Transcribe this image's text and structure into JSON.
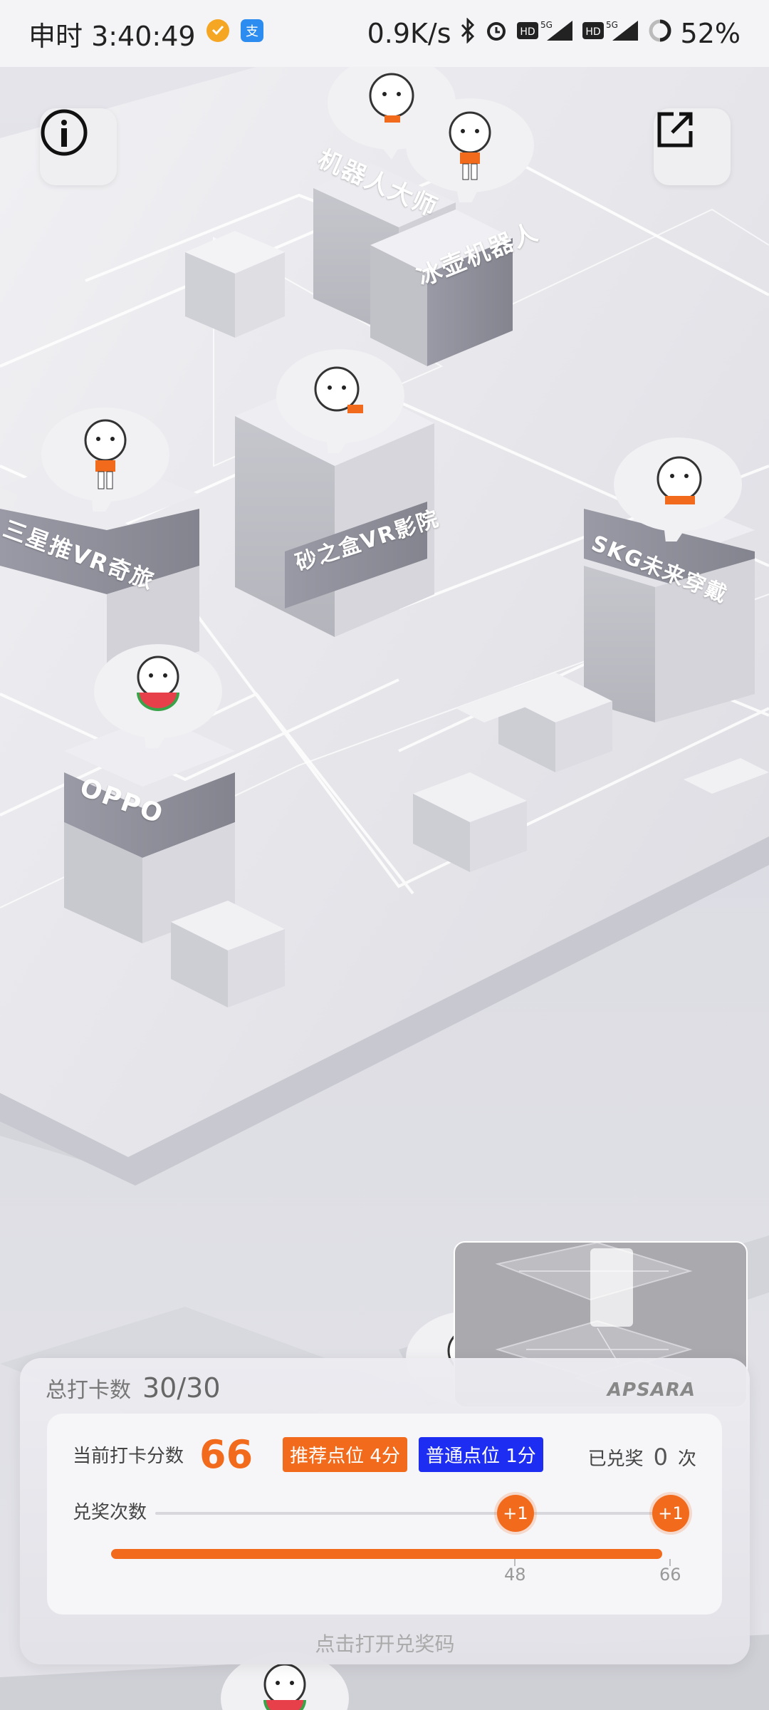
{
  "status_bar": {
    "time": "申时 3:40:49",
    "net_speed": "0.9K/s",
    "battery": "52%"
  },
  "map": {
    "buildings": [
      "机器人大师",
      "冰壶机器人",
      "砂之盒VR影院",
      "三星推VR奇旅",
      "SKG未来穿戴",
      "OPPO"
    ]
  },
  "panel": {
    "total_label": "总打卡数",
    "total_value": "30/30",
    "brand": "APSARA",
    "score_label": "当前打卡分数",
    "score_value": "66",
    "tag_recommended": "推荐点位 4分",
    "tag_normal": "普通点位 1分",
    "redeemed_label": "已兑奖",
    "redeemed_value": "0",
    "redeemed_unit": "次",
    "redeem_count_label": "兑奖次数",
    "plus_a": "+1",
    "plus_b": "+1",
    "tick_a": "48",
    "tick_b": "66",
    "progress": 1.0,
    "footer": "点击打开兑奖码"
  },
  "colors": {
    "accent": "#f26b1d",
    "normal_tag": "#1d2ef2"
  },
  "icons": {
    "info": "info-icon",
    "share": "share-icon"
  }
}
